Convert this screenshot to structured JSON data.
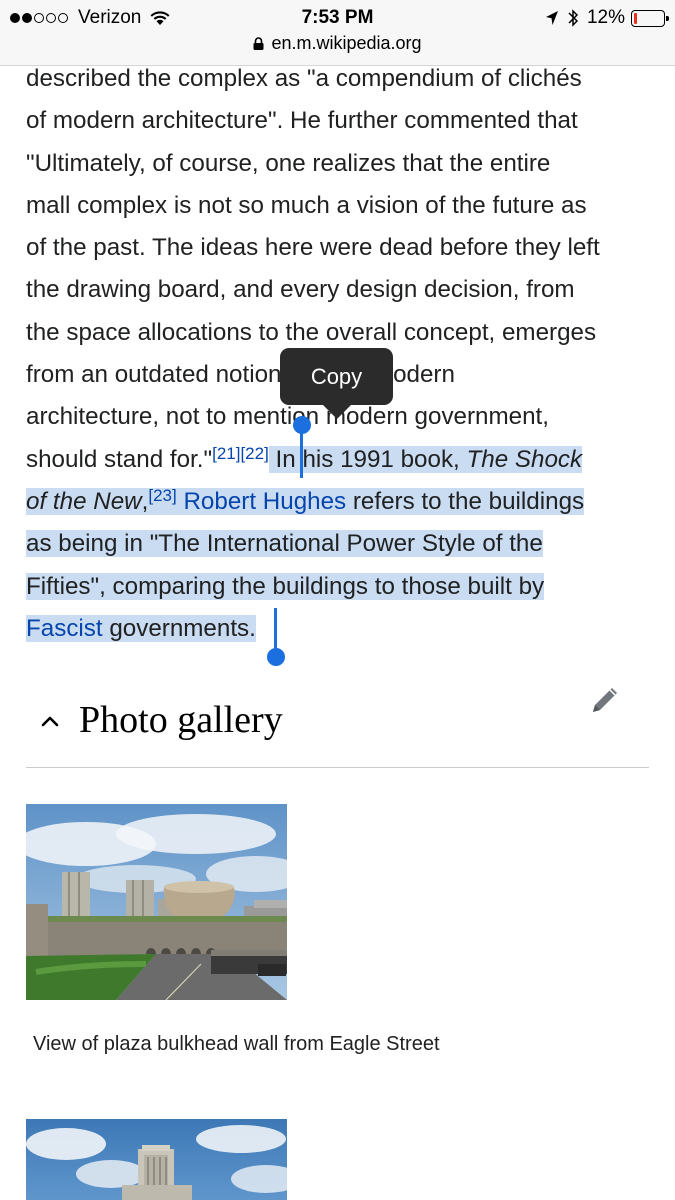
{
  "status_bar": {
    "carrier": "Verizon",
    "time": "7:53 PM",
    "battery": "12%",
    "battery_level": 0.12
  },
  "url_bar": {
    "url": "en.m.wikipedia.org"
  },
  "article": {
    "lines_unselected": [
      "described the complex as \"a compendium of clichés",
      "of modern architecture\". He further commented that",
      "\"Ultimately, of course, one realizes that the entire",
      "mall complex is not so much a vision of the future as",
      "of the past. The ideas here were dead before they left",
      "the drawing board, and every design decision, from",
      "the space allocations to the overall concept, emerges",
      "from an outdated notion of what modern",
      "architecture, not to mention modern government,"
    ],
    "line10_text": "should stand for.\"",
    "ref_21": "[21]",
    "ref_22": "[22]",
    "sel_line10": "In his 1991 book, ",
    "book_title_part1": "The Shock",
    "book_title_part2": "of the New",
    "comma": ",",
    "ref_23": "[23]",
    "link_robert_hughes": "Robert Hughes",
    "sel_line11_rest": " refers to the buildings",
    "sel_line12": "as being in \"The International Power Style of the",
    "sel_line13": "Fifties\", comparing the buildings to those built by",
    "link_fascist": "Fascist",
    "sel_line14_rest": " governments."
  },
  "copy_menu": {
    "label": "Copy"
  },
  "section": {
    "title": "Photo gallery"
  },
  "gallery": {
    "caption_1": "View of plaza bulkhead wall from Eagle Street"
  },
  "colors": {
    "link": "#0645ad",
    "selection": "#cadcf1",
    "handle": "#1b6fde",
    "popover": "#2b2b2b"
  }
}
